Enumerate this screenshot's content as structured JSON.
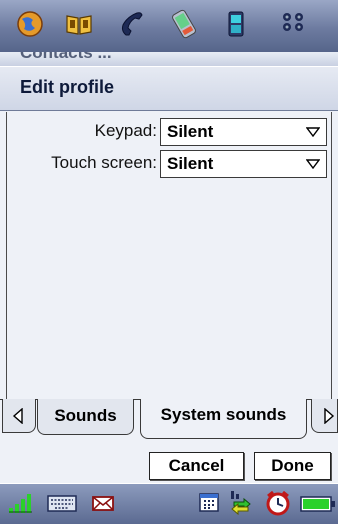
{
  "launcher": {
    "icons": [
      "globe-icon",
      "book-icon",
      "phone-handset-icon",
      "pda-icon",
      "mobile-phone-icon",
      "app-grid-icon"
    ],
    "obscured_title": "Contacts ..."
  },
  "dialog": {
    "title": "Edit profile",
    "fields": [
      {
        "label": "Keypad:",
        "value": "Silent"
      },
      {
        "label": "Touch screen:",
        "value": "Silent"
      }
    ],
    "tabs": [
      {
        "label": "Sounds",
        "selected": false
      },
      {
        "label": "System sounds",
        "selected": true
      }
    ],
    "buttons": {
      "cancel": "Cancel",
      "done": "Done"
    }
  },
  "statusbar": {
    "icons": [
      "signal-strength-icon",
      "keyboard-icon",
      "message-envelope-icon",
      "calendar-icon",
      "data-connection-icon",
      "alarm-clock-icon",
      "battery-icon"
    ]
  },
  "colors": {
    "launcher_bg": "#6d7ba0",
    "dialog_bg": "#eef1f7",
    "header_bg": "#cfd6e6",
    "statusbar_bg": "#5b6a91"
  }
}
